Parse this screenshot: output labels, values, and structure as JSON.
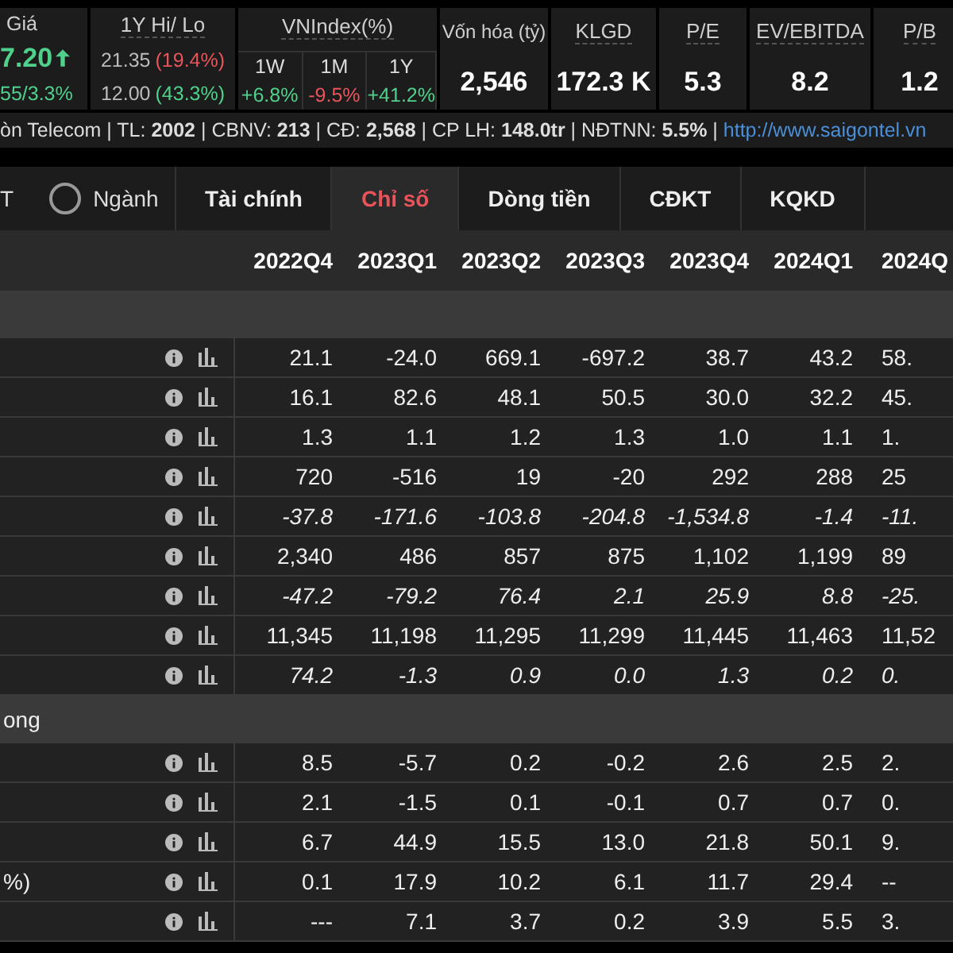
{
  "quote": {
    "price_label": "Giá",
    "price": "7.20",
    "up": true,
    "change": "55/3.3%",
    "hilo": {
      "title": "1Y Hi/ Lo",
      "rows": [
        {
          "value": "21.35",
          "pct": "(19.4%)",
          "up": false
        },
        {
          "value": "12.00",
          "pct": "(43.3%)",
          "up": true
        }
      ]
    },
    "vnindex": {
      "title": "VNIndex(%)",
      "periods": [
        {
          "label": "1W",
          "value": "+6.8%",
          "up": true
        },
        {
          "label": "1M",
          "value": "-9.5%",
          "up": false
        },
        {
          "label": "1Y",
          "value": "+41.2%",
          "up": true
        }
      ]
    },
    "metrics": [
      {
        "label": "Vốn hóa (tỷ)",
        "value": "2,546"
      },
      {
        "label": "KLGD",
        "value": "172.3 K"
      },
      {
        "label": "P/E",
        "value": "5.3"
      },
      {
        "label": "EV/EBITDA",
        "value": "8.2"
      },
      {
        "label": "P/B",
        "value": "1.2"
      }
    ]
  },
  "info_line": {
    "text": "òn Telecom | TL:  **2002** | CBNV:  **213** | CĐ:  **2,568** | CP LH: **148.0tr** | NĐTNN:   **5.5%** | ",
    "link": "http://www.saigontel.vn"
  },
  "scope": [
    {
      "label": "T",
      "selected": true
    },
    {
      "label": "Ngành",
      "selected": false
    }
  ],
  "tabs": [
    {
      "label": "Tài chính",
      "selected": false
    },
    {
      "label": "Chỉ số",
      "selected": true
    },
    {
      "label": "Dòng tiền",
      "selected": false
    },
    {
      "label": "CĐKT",
      "selected": false
    },
    {
      "label": "KQKD",
      "selected": false
    }
  ],
  "table": {
    "columns": [
      "2022Q4",
      "2023Q1",
      "2023Q2",
      "2023Q3",
      "2023Q4",
      "2024Q1",
      "2024Q"
    ],
    "sections": [
      {
        "rows": [
          {
            "italic": false,
            "values": [
              "21.1",
              "-24.0",
              "669.1",
              "-697.2",
              "38.7",
              "43.2",
              "58."
            ]
          },
          {
            "italic": false,
            "values": [
              "16.1",
              "82.6",
              "48.1",
              "50.5",
              "30.0",
              "32.2",
              "45."
            ]
          },
          {
            "italic": false,
            "values": [
              "1.3",
              "1.1",
              "1.2",
              "1.3",
              "1.0",
              "1.1",
              "1."
            ]
          },
          {
            "italic": false,
            "values": [
              "720",
              "-516",
              "19",
              "-20",
              "292",
              "288",
              "25"
            ]
          },
          {
            "italic": true,
            "values": [
              "-37.8",
              "-171.6",
              "-103.8",
              "-204.8",
              "-1,534.8",
              "-1.4",
              "-11."
            ]
          },
          {
            "italic": false,
            "values": [
              "2,340",
              "486",
              "857",
              "875",
              "1,102",
              "1,199",
              "89"
            ]
          },
          {
            "italic": true,
            "values": [
              "-47.2",
              "-79.2",
              "76.4",
              "2.1",
              "25.9",
              "8.8",
              "-25."
            ]
          },
          {
            "italic": false,
            "values": [
              "11,345",
              "11,198",
              "11,295",
              "11,299",
              "11,445",
              "11,463",
              "11,52"
            ]
          },
          {
            "italic": true,
            "values": [
              "74.2",
              "-1.3",
              "0.9",
              "0.0",
              "1.3",
              "0.2",
              "0."
            ]
          }
        ]
      },
      {
        "label": "ong",
        "rows": [
          {
            "italic": false,
            "values": [
              "8.5",
              "-5.7",
              "0.2",
              "-0.2",
              "2.6",
              "2.5",
              "2."
            ]
          },
          {
            "italic": false,
            "values": [
              "2.1",
              "-1.5",
              "0.1",
              "-0.1",
              "0.7",
              "0.7",
              "0."
            ]
          },
          {
            "italic": false,
            "values": [
              "6.7",
              "44.9",
              "15.5",
              "13.0",
              "21.8",
              "50.1",
              "9."
            ]
          },
          {
            "label": "%)",
            "italic": false,
            "values": [
              "0.1",
              "17.9",
              "10.2",
              "6.1",
              "11.7",
              "29.4",
              "--"
            ]
          },
          {
            "italic": false,
            "values": [
              "---",
              "7.1",
              "3.7",
              "0.2",
              "3.9",
              "5.5",
              "3."
            ]
          }
        ]
      }
    ]
  }
}
